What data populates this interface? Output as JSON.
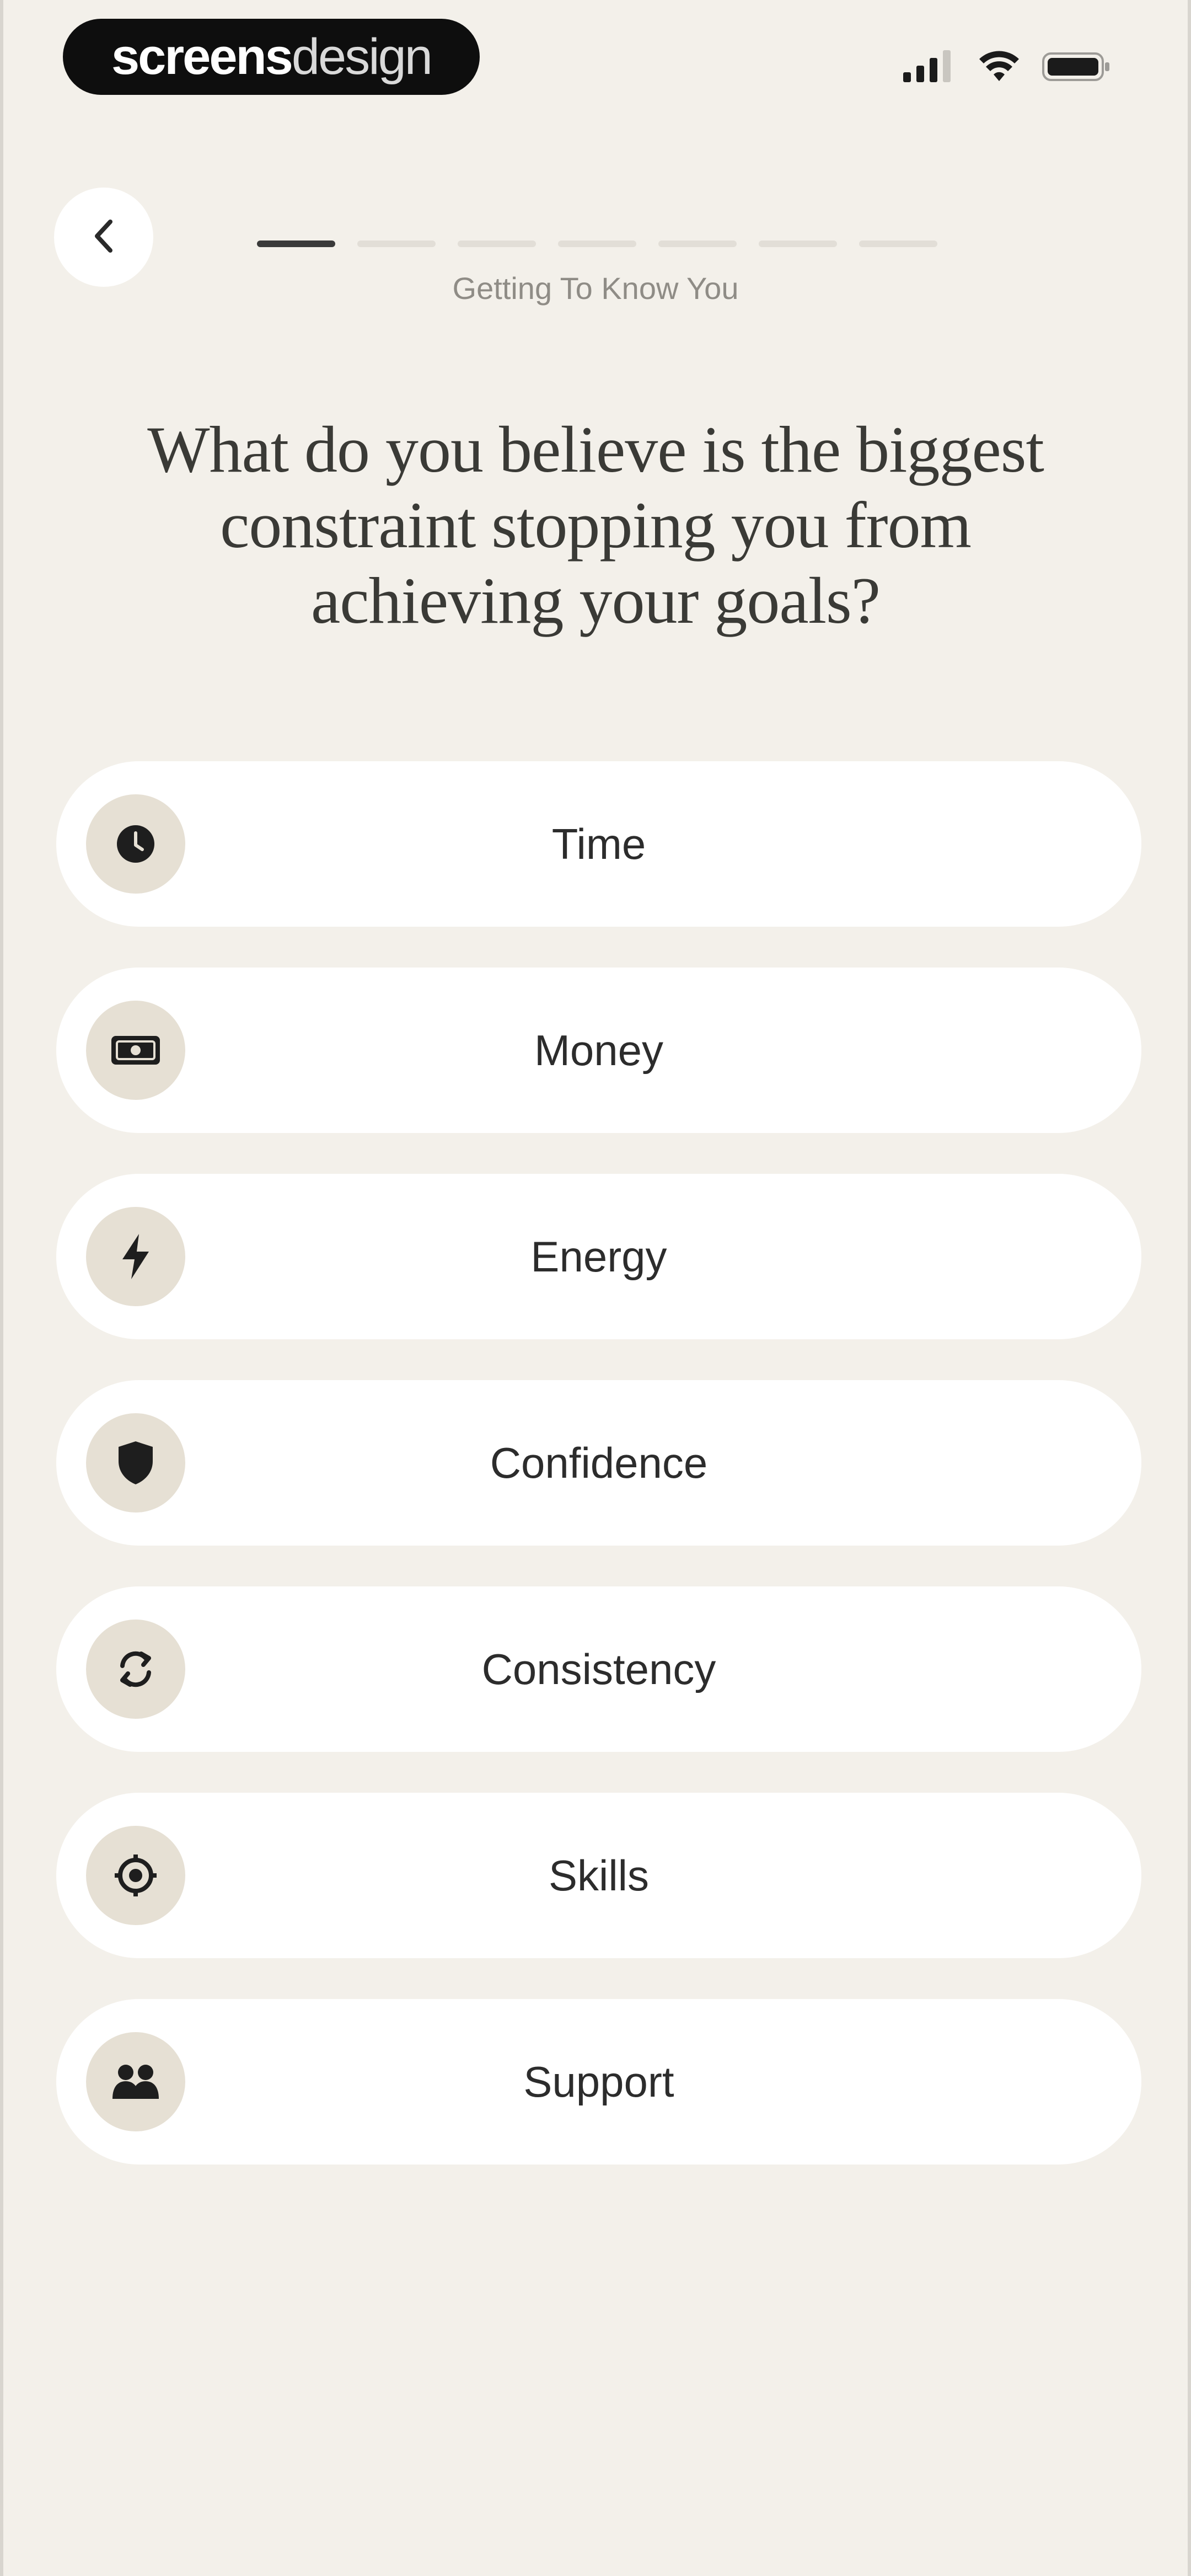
{
  "status_bar": {
    "brand_bold": "screens",
    "brand_light": "design",
    "icons": [
      "signal-icon",
      "wifi-icon",
      "battery-icon"
    ]
  },
  "nav": {
    "back_icon": "chevron-left-icon",
    "progress_total": 7,
    "progress_current": 1,
    "step_label": "Getting To Know You"
  },
  "question": "What do you believe is the biggest constraint stopping you from achieving your goals?",
  "options": [
    {
      "label": "Time",
      "icon": "clock-icon"
    },
    {
      "label": "Money",
      "icon": "money-icon"
    },
    {
      "label": "Energy",
      "icon": "lightning-icon"
    },
    {
      "label": "Confidence",
      "icon": "shield-icon"
    },
    {
      "label": "Consistency",
      "icon": "repeat-icon"
    },
    {
      "label": "Skills",
      "icon": "target-icon"
    },
    {
      "label": "Support",
      "icon": "people-icon"
    }
  ],
  "colors": {
    "background": "#f3f0ea",
    "card": "#ffffff",
    "icon_circle": "#e6e0d4",
    "progress_active": "#3a3a3a",
    "progress_inactive": "#e2ded7",
    "text_primary": "#2c2c2c",
    "text_muted": "#8f8c86"
  }
}
